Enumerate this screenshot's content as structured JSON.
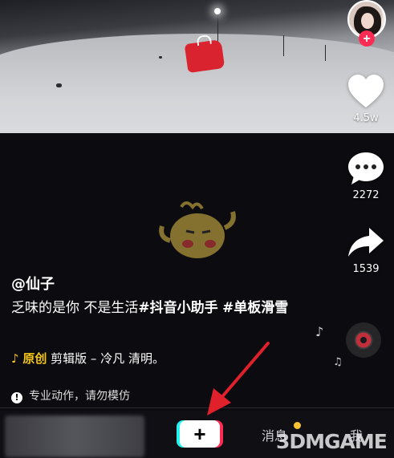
{
  "rail": {
    "like_count": "4.5w",
    "comment_count": "2272",
    "share_count": "1539",
    "follow_label": "+"
  },
  "caption": {
    "author": "@仙子",
    "text_plain": "乏味的是你  不是生活",
    "hashtag_1": "#抖音小助手",
    "hashtag_2": "#单板滑雪",
    "music_badge": "原创",
    "music_title": "剪辑版 – 冷凡    清明。",
    "warning": "专业动作，请勿模仿"
  },
  "nav": {
    "create_label": "+",
    "messages_label": "消息",
    "me_label": "我"
  },
  "watermark": {
    "text": "3DMGAME"
  },
  "colors": {
    "accent_red": "#fe2c55",
    "accent_cyan": "#25f4ee",
    "music_yellow": "#f5c518"
  }
}
